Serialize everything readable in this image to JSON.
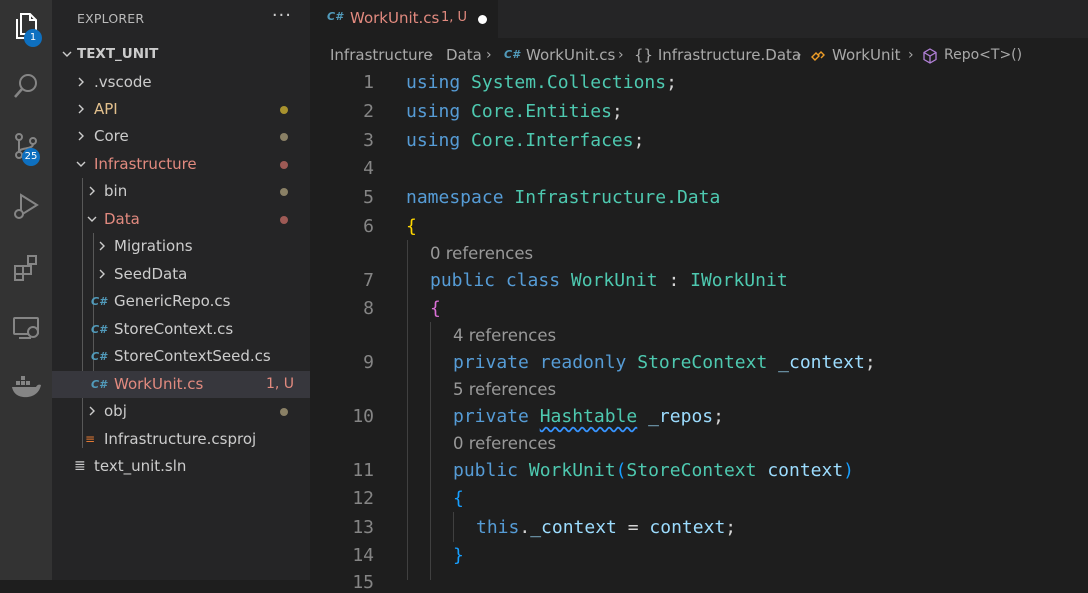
{
  "activity_bar": {
    "explorer_badge": "1",
    "scm_badge": "25"
  },
  "explorer": {
    "title": "EXPLORER",
    "more": "···",
    "root": "TEXT_UNIT",
    "items": [
      {
        "label": "​.vscode",
        "color": "#cccccc"
      },
      {
        "label": "API",
        "color": "#e2c08d"
      },
      {
        "label": "Core",
        "color": "#cccccc"
      },
      {
        "label": "Infrastructure",
        "color": "#e28a7f"
      },
      {
        "label": "bin",
        "color": "#cccccc"
      },
      {
        "label": "Data",
        "color": "#e28a7f"
      },
      {
        "label": "Migrations",
        "color": "#cccccc"
      },
      {
        "label": "SeedData",
        "color": "#cccccc"
      },
      {
        "label": "GenericRepo.cs",
        "color": "#cccccc"
      },
      {
        "label": "StoreContext.cs",
        "color": "#cccccc"
      },
      {
        "label": "StoreContextSeed.cs",
        "color": "#cccccc"
      },
      {
        "label": "WorkUnit.cs",
        "color": "#e28a7f",
        "status": "1, U"
      },
      {
        "label": "obj",
        "color": "#cccccc"
      },
      {
        "label": "Infrastructure.csproj",
        "color": "#cccccc"
      },
      {
        "label": "text_unit.sln",
        "color": "#cccccc"
      }
    ]
  },
  "tab": {
    "icon": "C#",
    "label": "WorkUnit.cs",
    "status": "1, U"
  },
  "breadcrumb": {
    "items": [
      "Infrastructure",
      "Data",
      "WorkUnit.cs",
      "{} Infrastructure.Data",
      "WorkUnit",
      "Repo<T>()"
    ]
  },
  "editor": {
    "line_numbers": [
      "1",
      "2",
      "3",
      "4",
      "5",
      "6",
      "7",
      "8",
      "9",
      "10",
      "11",
      "12",
      "13",
      "14",
      "15"
    ],
    "code": {
      "l1_kw": "using",
      "l1_ns": "System.Collections",
      "l1_end": ";",
      "l2_kw": "using",
      "l2_ns": "Core.Entities",
      "l2_end": ";",
      "l3_kw": "using",
      "l3_ns": "Core.Interfaces",
      "l3_end": ";",
      "l5_kw": "namespace",
      "l5_ns": "Infrastructure.Data",
      "l6_brace": "{",
      "lens1": "0 references",
      "l7_kw1": "public",
      "l7_kw2": "class",
      "l7_name": "WorkUnit",
      "l7_colon": " : ",
      "l7_iface": "IWorkUnit",
      "l8_brace": "{",
      "lens2": "4 references",
      "l9_kw1": "private",
      "l9_kw2": "readonly",
      "l9_type": "StoreContext",
      "l9_var": "_context",
      "l9_end": ";",
      "lens3": "5 references",
      "l10_kw": "private",
      "l10_type": "Hashtable",
      "l10_var": "_repos",
      "l10_end": ";",
      "lens4": "0 references",
      "l11_kw": "public",
      "l11_name": "WorkUnit",
      "l11_open": "(",
      "l11_type": "StoreContext",
      "l11_param": "context",
      "l11_close": ")",
      "l12_brace": "{",
      "l13_this": "this",
      "l13_dot": ".",
      "l13_var": "_context",
      "l13_eq": " = ",
      "l13_val": "context",
      "l13_end": ";",
      "l14_brace": "}"
    }
  }
}
